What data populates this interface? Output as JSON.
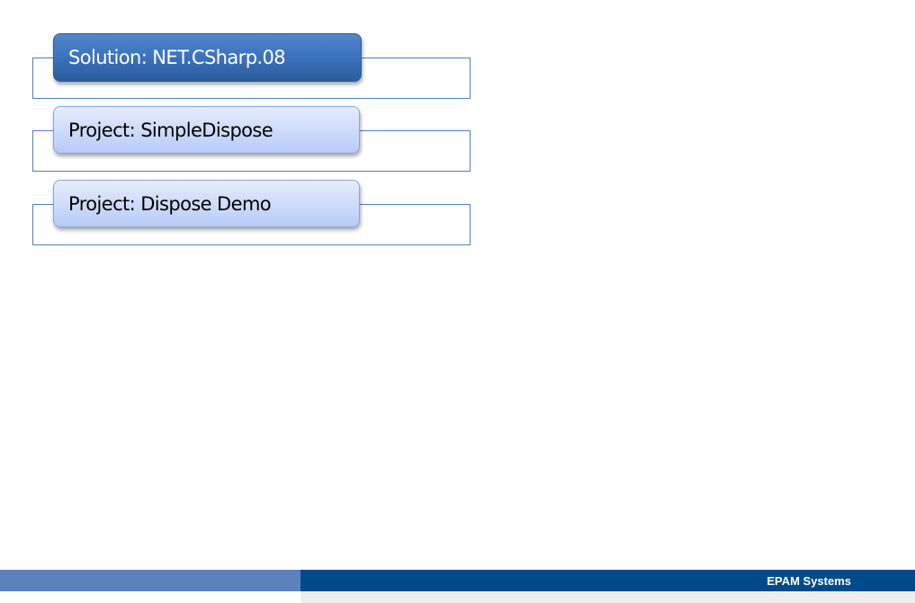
{
  "diagram": {
    "nodes": [
      {
        "label": "Solution: NET.CSharp.08",
        "kind": "solution"
      },
      {
        "label": "Project: SimpleDispose",
        "kind": "project"
      },
      {
        "label": "Project: Dispose Demo",
        "kind": "project"
      }
    ]
  },
  "footer": {
    "brand": "EPAM Systems"
  },
  "colors": {
    "frame_border": "#4f81bd",
    "solution_fill": "#3d74be",
    "project_fill": "#cfdcfb",
    "footer_light": "#5b82bd",
    "footer_dark": "#004a8c"
  }
}
